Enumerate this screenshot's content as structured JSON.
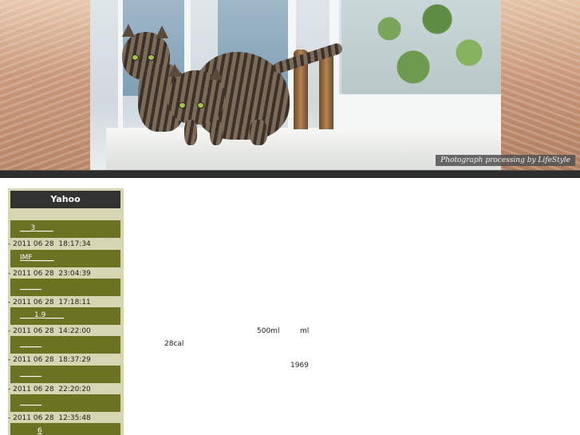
{
  "banner": {
    "credit": "Photograph processing   by   LifeStyle"
  },
  "sidebar": {
    "header": "Yahoo",
    "entries": [
      {
        "title": "___3_____",
        "date": "- 2011 06 28  18:17:34"
      },
      {
        "title": "IMF______",
        "date": "- 2011 06 28  23:04:39"
      },
      {
        "title": "______",
        "date": "- 2011 06 28  17:18:11"
      },
      {
        "title": "____1.9_____",
        "date": "- 2011 06 28  14:22:00"
      },
      {
        "title": "______",
        "date": "- 2011 06 28  18:37:29"
      },
      {
        "title": "______",
        "date": "- 2011 06 28  22:20:20"
      },
      {
        "title": "______",
        "date": "- 2011 06 28  12:35:48"
      },
      {
        "title": "6",
        "date": ""
      }
    ]
  },
  "main": {
    "volume": "500ml",
    "unit": "ml",
    "calories": "28cal",
    "year": "1969"
  }
}
